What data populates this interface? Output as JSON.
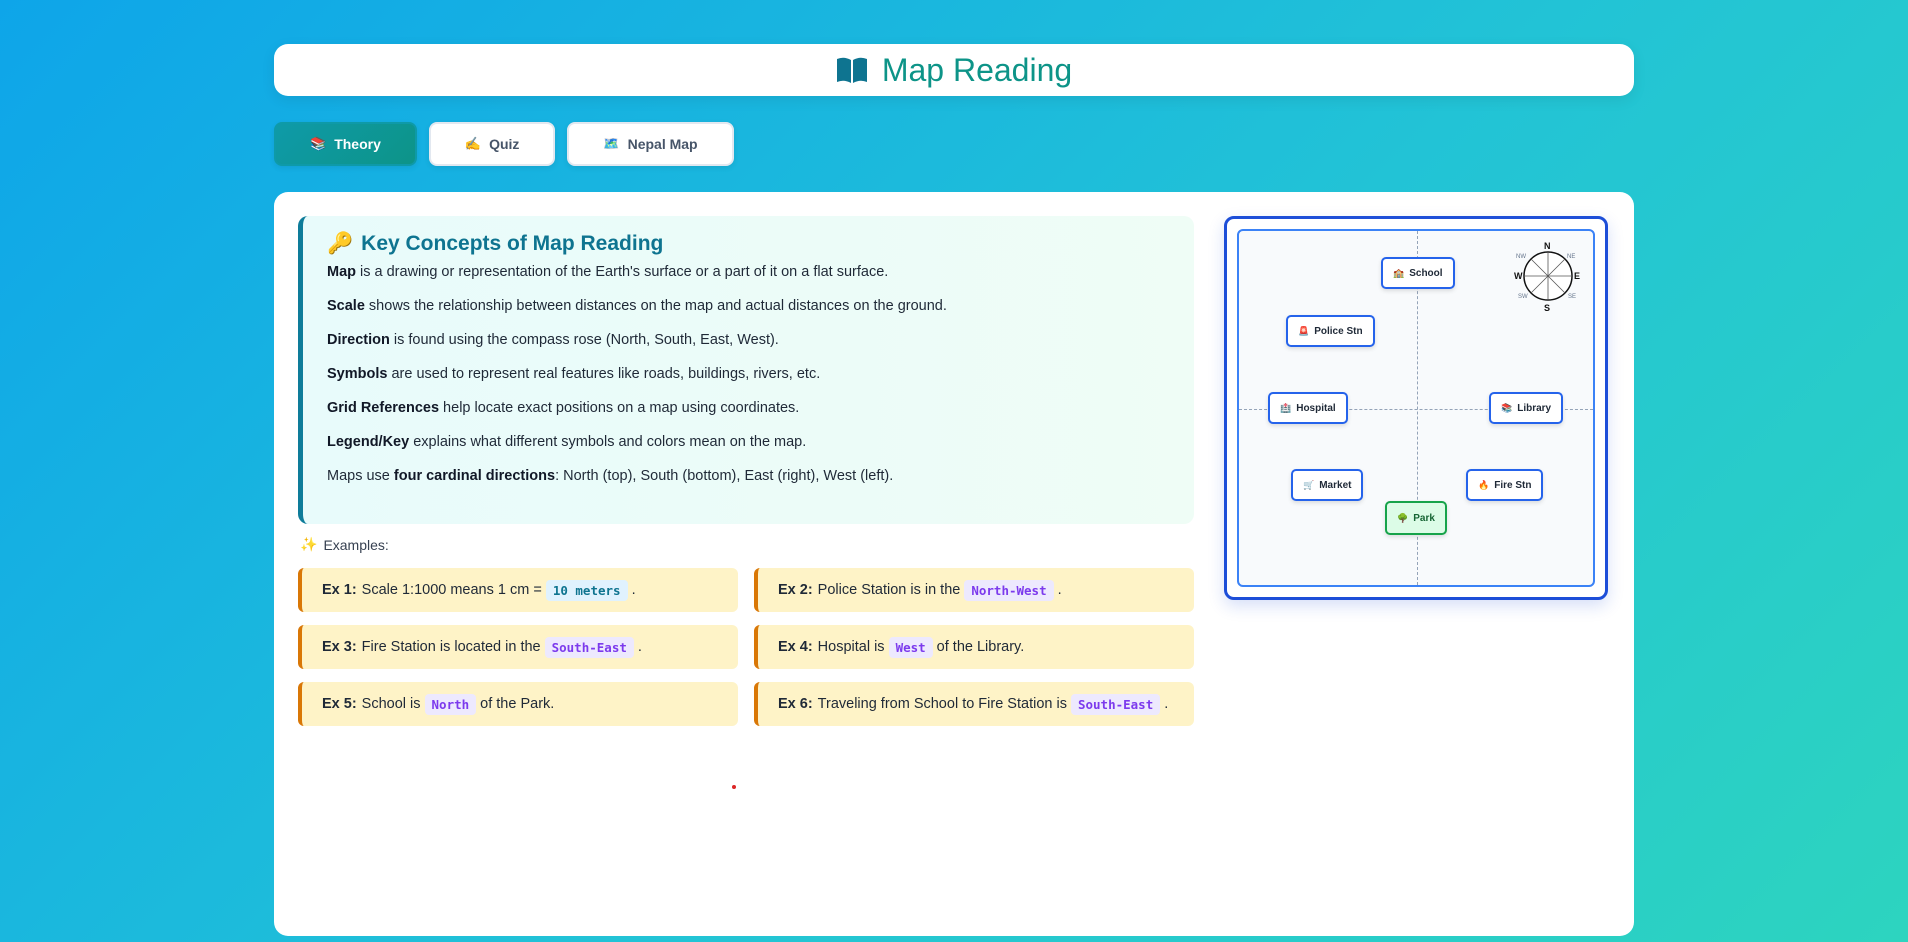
{
  "header": {
    "title": "Map Reading",
    "icon": "open-book-icon",
    "color": "#0d9488"
  },
  "tabs": [
    {
      "label": "Theory",
      "icon": "books-icon",
      "active": true
    },
    {
      "label": "Quiz",
      "icon": "writing-hand-icon",
      "active": false
    },
    {
      "label": "Nepal Map",
      "icon": "map-icon",
      "active": false
    }
  ],
  "concepts": {
    "title": "Key Concepts of Map Reading",
    "title_icon": "key-icon",
    "items": [
      {
        "term": "Map",
        "text": " is a drawing or representation of the Earth's surface or a part of it on a flat surface."
      },
      {
        "term": "Scale",
        "text": " shows the relationship between distances on the map and actual distances on the ground."
      },
      {
        "term": "Direction",
        "text": " is found using the compass rose (North, South, East, West)."
      },
      {
        "term": "Symbols",
        "text": " are used to represent real features like roads, buildings, rivers, etc."
      },
      {
        "term": "Grid References",
        "text": " help locate exact positions on a map using coordinates."
      },
      {
        "term": "Legend/Key",
        "text": " explains what different symbols and colors mean on the map."
      }
    ],
    "last": {
      "pre": "Maps use ",
      "term": "four cardinal directions",
      "post": ": North (top), South (bottom), East (right), West (left)."
    }
  },
  "examples": {
    "label": "Examples:",
    "icon": "sparkles-icon",
    "items": [
      {
        "id": "Ex 1:",
        "pre": "Scale 1:1000 means 1 cm =",
        "code": "10 meters",
        "post": "."
      },
      {
        "id": "Ex 2:",
        "pre": "Police Station is in the",
        "code": "North-West",
        "post": "."
      },
      {
        "id": "Ex 3:",
        "pre": "Fire Station is located in the",
        "code": "South-East",
        "post": "."
      },
      {
        "id": "Ex 4:",
        "pre": "Hospital is",
        "code": "West",
        "post": "of the Library."
      },
      {
        "id": "Ex 5:",
        "pre": "School is",
        "code": "North",
        "post": "of the Park."
      },
      {
        "id": "Ex 6:",
        "pre": "Traveling from School to Fire Station is",
        "code": "South-East",
        "post": "."
      }
    ]
  },
  "map": {
    "places": [
      {
        "name": "School",
        "icon": "school-icon"
      },
      {
        "name": "Police Stn",
        "icon": "police-icon"
      },
      {
        "name": "Hospital",
        "icon": "hospital-icon"
      },
      {
        "name": "Library",
        "icon": "library-icon"
      },
      {
        "name": "Market",
        "icon": "cart-icon"
      },
      {
        "name": "Fire Stn",
        "icon": "fire-icon"
      },
      {
        "name": "Park",
        "icon": "tree-icon"
      }
    ],
    "compass": {
      "n": "N",
      "s": "S",
      "e": "E",
      "w": "W",
      "nw": "NW",
      "ne": "NE",
      "sw": "SW",
      "se": "SE"
    }
  }
}
